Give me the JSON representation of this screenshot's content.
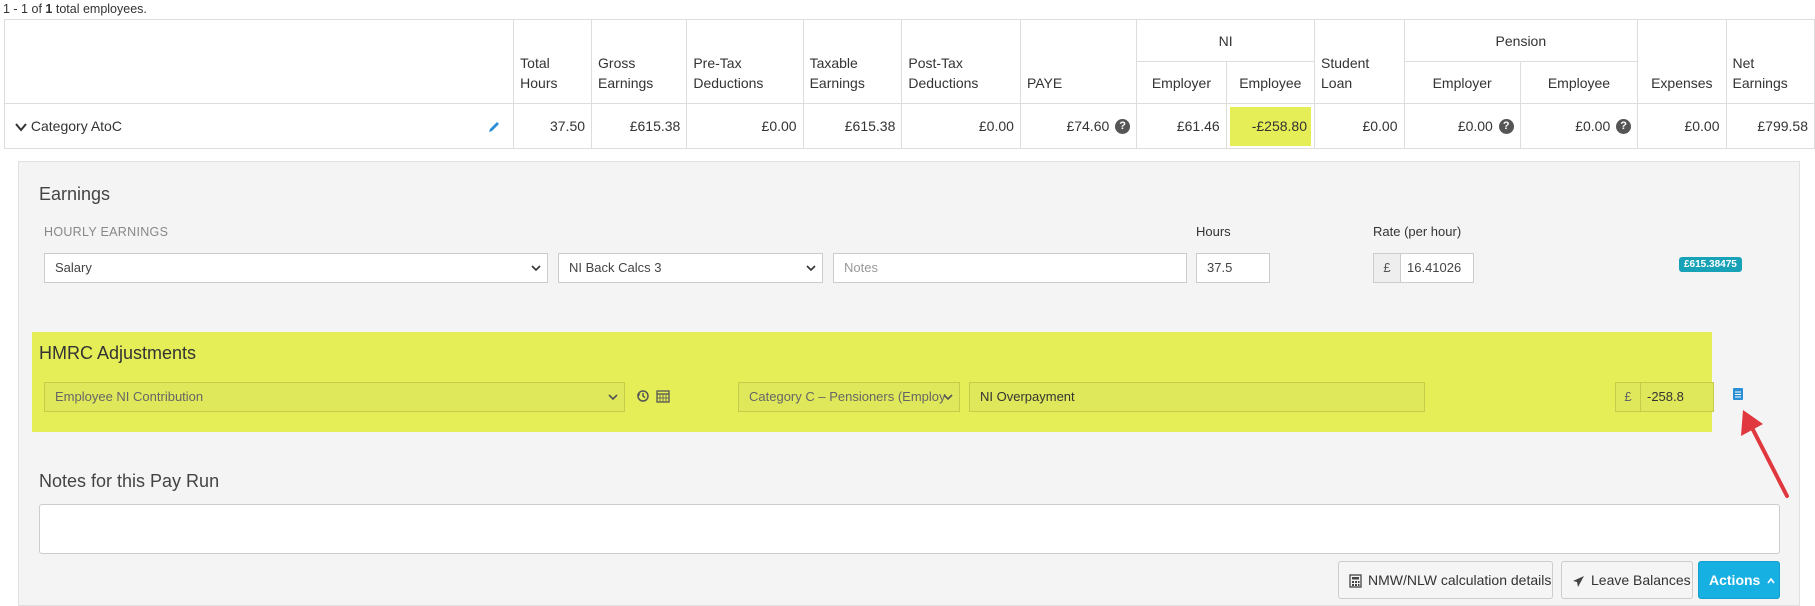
{
  "summary": {
    "range": "1 - 1",
    "of_word": "of",
    "count": "1",
    "suffix": "total employees."
  },
  "table": {
    "headers": {
      "total_hours": "Total Hours",
      "gross_earnings": "Gross Earnings",
      "pretax": "Pre-Tax Deductions",
      "taxable": "Taxable Earnings",
      "posttax": "Post-Tax Deductions",
      "paye": "PAYE",
      "ni": "NI",
      "ni_employer": "Employer",
      "ni_employee": "Employee",
      "student_loan": "Student Loan",
      "pension": "Pension",
      "pension_employer": "Employer",
      "pension_employee": "Employee",
      "expenses": "Expenses",
      "net_earnings": "Net Earnings"
    },
    "row": {
      "category": "Category AtoC",
      "total_hours": "37.50",
      "gross_earnings": "£615.38",
      "pretax": "£0.00",
      "taxable": "£615.38",
      "posttax": "£0.00",
      "paye": "£74.60",
      "ni_employer": "£61.46",
      "ni_employee": "-£258.80",
      "student_loan": "£0.00",
      "pension_employer": "£0.00",
      "pension_employee": "£0.00",
      "expenses": "£0.00",
      "net_earnings": "£799.58"
    }
  },
  "earnings": {
    "heading": "Earnings",
    "hourly_label": "HOURLY EARNINGS",
    "hours_label": "Hours",
    "rate_label": "Rate (per hour)",
    "type_value": "Salary",
    "calc_value": "NI Back Calcs 3",
    "notes_placeholder": "Notes",
    "hours_value": "37.5",
    "currency": "£",
    "rate_value": "16.41026",
    "total_badge": "£615.38475"
  },
  "hmrc": {
    "heading": "HMRC Adjustments",
    "type_value": "Employee NI Contribution",
    "category_value": "Category C – Pensioners (Employ",
    "notes_value": "NI Overpayment",
    "currency": "£",
    "amount_value": "-258.8"
  },
  "notes": {
    "heading": "Notes for this Pay Run"
  },
  "buttons": {
    "nmw": "NMW/NLW calculation details",
    "leave": "Leave Balances",
    "actions": "Actions"
  },
  "colors": {
    "highlight": "#e5ee57",
    "accent": "#17b0e3",
    "arrow": "#e0383e"
  }
}
